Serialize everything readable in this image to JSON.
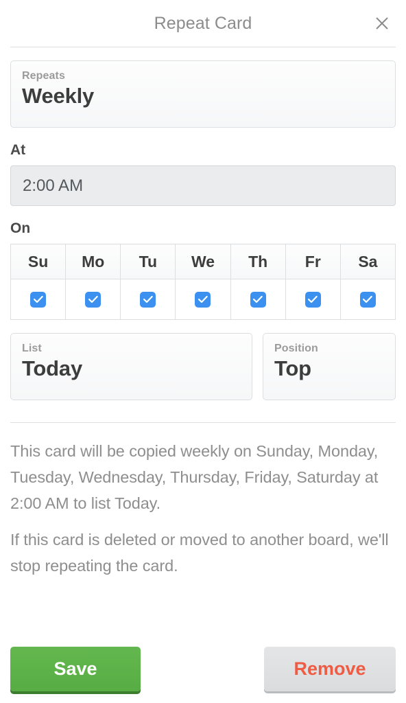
{
  "header": {
    "title": "Repeat Card",
    "close_icon": "close-icon"
  },
  "repeats": {
    "label": "Repeats",
    "value": "Weekly"
  },
  "at": {
    "section_label": "At",
    "value": "2:00 AM",
    "placeholder": "2:00 AM"
  },
  "on": {
    "section_label": "On",
    "days": [
      {
        "abbr": "Su",
        "name": "Sunday",
        "checked": true
      },
      {
        "abbr": "Mo",
        "name": "Monday",
        "checked": true
      },
      {
        "abbr": "Tu",
        "name": "Tuesday",
        "checked": true
      },
      {
        "abbr": "We",
        "name": "Wednesday",
        "checked": true
      },
      {
        "abbr": "Th",
        "name": "Thursday",
        "checked": true
      },
      {
        "abbr": "Fr",
        "name": "Friday",
        "checked": true
      },
      {
        "abbr": "Sa",
        "name": "Saturday",
        "checked": true
      }
    ]
  },
  "list": {
    "label": "List",
    "value": "Today"
  },
  "position": {
    "label": "Position",
    "value": "Top"
  },
  "description": {
    "line1": "This card will be copied weekly on Sunday, Monday, Tuesday, Wednesday, Thursday, Friday, Saturday at 2:00 AM to list Today.",
    "line2": "If this card is deleted or moved to another board, we'll stop repeating the card."
  },
  "footer": {
    "save_label": "Save",
    "remove_label": "Remove"
  },
  "colors": {
    "accent_blue": "#3c90f0",
    "save_green": "#5cb246",
    "remove_red": "#ef5b43",
    "border_gray": "#dcdfe2",
    "muted_text": "#8e8e8e",
    "dark_text": "#3d3d3d"
  }
}
